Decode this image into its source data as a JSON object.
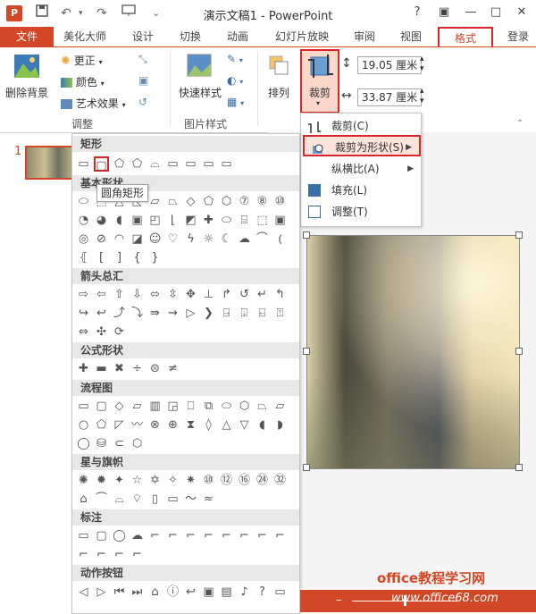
{
  "app": {
    "logo_text": "P",
    "title": "演示文稿1 - PowerPoint",
    "help": "?",
    "min": "—",
    "restore": "□",
    "close": "✕",
    "login": "登录"
  },
  "tabs": [
    "文件",
    "美化大师",
    "设计",
    "切换",
    "动画",
    "幻灯片放映",
    "审阅",
    "视图",
    "格式"
  ],
  "ribbon": {
    "remove_bg": "删除背景",
    "correct": "更正",
    "color": "颜色",
    "art_effect": "艺术效果",
    "group_adjust": "调整",
    "quick_style": "快速样式",
    "group_pic_style": "图片样式",
    "arrange": "排列",
    "crop": "裁剪",
    "height_value": "19.05 厘米",
    "width_value": "33.87 厘米"
  },
  "slide_panel": {
    "number": "1"
  },
  "gallery": {
    "sections": [
      "矩形",
      "基本形状",
      "箭头总汇",
      "公式形状",
      "流程图",
      "星与旗帜",
      "标注",
      "动作按钮"
    ],
    "tooltip": "圆角矩形"
  },
  "crop_menu": {
    "items": [
      "裁剪(C)",
      "裁剪为形状(S)",
      "纵横比(A)",
      "填充(L)",
      "调整(T)"
    ]
  },
  "watermark": {
    "text": "office教程学习网",
    "url": "www.office68.com"
  },
  "colors": {
    "accent": "#d24726",
    "highlight": "#d9252b"
  }
}
